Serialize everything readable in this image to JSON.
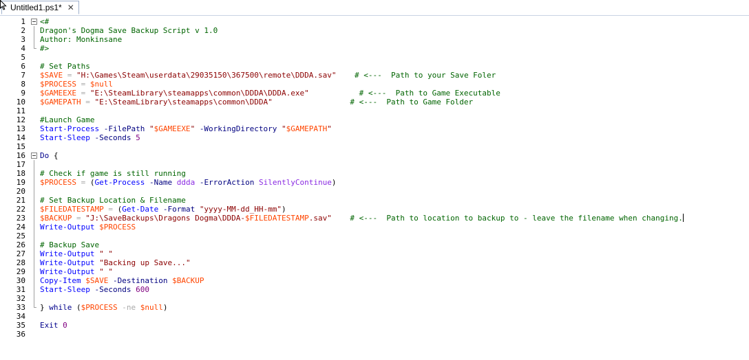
{
  "tab": {
    "title": "Untitled1.ps1*",
    "close_glyph": "✕"
  },
  "lines": [
    {
      "n": "1",
      "fold": "start",
      "tokens": [
        {
          "c": "comment",
          "t": "<#"
        }
      ]
    },
    {
      "n": "2",
      "fold": "line",
      "tokens": [
        {
          "c": "comment",
          "t": "Dragon's Dogma Save Backup Script v 1.0"
        }
      ]
    },
    {
      "n": "3",
      "fold": "line",
      "tokens": [
        {
          "c": "comment",
          "t": "Author: Monkinsane"
        }
      ]
    },
    {
      "n": "4",
      "fold": "end",
      "tokens": [
        {
          "c": "comment",
          "t": "#>"
        }
      ]
    },
    {
      "n": "5",
      "fold": "",
      "tokens": []
    },
    {
      "n": "6",
      "fold": "",
      "tokens": [
        {
          "c": "comment",
          "t": "# Set Paths"
        }
      ]
    },
    {
      "n": "7",
      "fold": "",
      "tokens": [
        {
          "c": "var",
          "t": "$SAVE"
        },
        {
          "c": "op",
          "t": " = "
        },
        {
          "c": "str",
          "t": "\"H:\\Games\\Steam\\userdata\\29035150\\367500\\remote\\DDDA.sav\""
        },
        {
          "c": "plain",
          "t": "    "
        },
        {
          "c": "comment",
          "t": "# <---  Path to your Save Foler"
        }
      ]
    },
    {
      "n": "8",
      "fold": "",
      "tokens": [
        {
          "c": "var",
          "t": "$PROCESS"
        },
        {
          "c": "op",
          "t": " = "
        },
        {
          "c": "var",
          "t": "$null"
        }
      ]
    },
    {
      "n": "9",
      "fold": "",
      "tokens": [
        {
          "c": "var",
          "t": "$GAMEEXE"
        },
        {
          "c": "op",
          "t": " = "
        },
        {
          "c": "str",
          "t": "\"E:\\SteamLibrary\\steamapps\\common\\DDDA\\DDDA.exe\""
        },
        {
          "c": "plain",
          "t": "           "
        },
        {
          "c": "comment",
          "t": "# <---  Path to Game Executable"
        }
      ]
    },
    {
      "n": "10",
      "fold": "",
      "tokens": [
        {
          "c": "var",
          "t": "$GAMEPATH"
        },
        {
          "c": "op",
          "t": " = "
        },
        {
          "c": "str",
          "t": "\"E:\\SteamLibrary\\steamapps\\common\\DDDA\""
        },
        {
          "c": "plain",
          "t": "                 "
        },
        {
          "c": "comment",
          "t": "# <---  Path to Game Folder"
        }
      ]
    },
    {
      "n": "11",
      "fold": "",
      "tokens": []
    },
    {
      "n": "12",
      "fold": "",
      "tokens": [
        {
          "c": "comment",
          "t": "#Launch Game"
        }
      ]
    },
    {
      "n": "13",
      "fold": "",
      "tokens": [
        {
          "c": "cmd",
          "t": "Start-Process"
        },
        {
          "c": "plain",
          "t": " "
        },
        {
          "c": "param",
          "t": "-FilePath"
        },
        {
          "c": "plain",
          "t": " "
        },
        {
          "c": "str",
          "t": "\""
        },
        {
          "c": "var",
          "t": "$GAMEEXE"
        },
        {
          "c": "str",
          "t": "\""
        },
        {
          "c": "plain",
          "t": " "
        },
        {
          "c": "param",
          "t": "-WorkingDirectory"
        },
        {
          "c": "plain",
          "t": " "
        },
        {
          "c": "str",
          "t": "\""
        },
        {
          "c": "var",
          "t": "$GAMEPATH"
        },
        {
          "c": "str",
          "t": "\""
        }
      ]
    },
    {
      "n": "14",
      "fold": "",
      "tokens": [
        {
          "c": "cmd",
          "t": "Start-Sleep"
        },
        {
          "c": "plain",
          "t": " "
        },
        {
          "c": "param",
          "t": "-Seconds"
        },
        {
          "c": "plain",
          "t": " "
        },
        {
          "c": "num",
          "t": "5"
        }
      ]
    },
    {
      "n": "15",
      "fold": "",
      "tokens": []
    },
    {
      "n": "16",
      "fold": "start",
      "tokens": [
        {
          "c": "kw",
          "t": "Do"
        },
        {
          "c": "plain",
          "t": " {"
        }
      ]
    },
    {
      "n": "17",
      "fold": "line",
      "tokens": []
    },
    {
      "n": "18",
      "fold": "line",
      "tokens": [
        {
          "c": "comment",
          "t": "# Check if game is still running"
        }
      ]
    },
    {
      "n": "19",
      "fold": "line",
      "tokens": [
        {
          "c": "var",
          "t": "$PROCESS"
        },
        {
          "c": "op",
          "t": " = "
        },
        {
          "c": "plain",
          "t": "("
        },
        {
          "c": "cmd",
          "t": "Get-Process"
        },
        {
          "c": "plain",
          "t": " "
        },
        {
          "c": "param",
          "t": "-Name"
        },
        {
          "c": "plain",
          "t": " "
        },
        {
          "c": "member",
          "t": "ddda"
        },
        {
          "c": "plain",
          "t": " "
        },
        {
          "c": "param",
          "t": "-ErrorAction"
        },
        {
          "c": "plain",
          "t": " "
        },
        {
          "c": "member",
          "t": "SilentlyContinue"
        },
        {
          "c": "plain",
          "t": ")"
        }
      ]
    },
    {
      "n": "20",
      "fold": "line",
      "tokens": []
    },
    {
      "n": "21",
      "fold": "line",
      "tokens": [
        {
          "c": "comment",
          "t": "# Set Backup Location & Filename"
        }
      ]
    },
    {
      "n": "22",
      "fold": "line",
      "tokens": [
        {
          "c": "var",
          "t": "$FILEDATESTAMP"
        },
        {
          "c": "op",
          "t": " = "
        },
        {
          "c": "plain",
          "t": "("
        },
        {
          "c": "cmd",
          "t": "Get-Date"
        },
        {
          "c": "plain",
          "t": " "
        },
        {
          "c": "param",
          "t": "-Format"
        },
        {
          "c": "plain",
          "t": " "
        },
        {
          "c": "str",
          "t": "\"yyyy-MM-dd_HH-mm\""
        },
        {
          "c": "plain",
          "t": ")"
        }
      ]
    },
    {
      "n": "23",
      "fold": "line",
      "caret": true,
      "tokens": [
        {
          "c": "var",
          "t": "$BACKUP"
        },
        {
          "c": "op",
          "t": " = "
        },
        {
          "c": "str",
          "t": "\"J:\\SaveBackups\\Dragons Dogma\\DDDA-"
        },
        {
          "c": "var",
          "t": "$FILEDATESTAMP"
        },
        {
          "c": "str",
          "t": ".sav\""
        },
        {
          "c": "plain",
          "t": "    "
        },
        {
          "c": "comment",
          "t": "# <---  Path to location to backup to - leave the filename when changing."
        }
      ]
    },
    {
      "n": "24",
      "fold": "line",
      "tokens": [
        {
          "c": "cmd",
          "t": "Write-Output"
        },
        {
          "c": "plain",
          "t": " "
        },
        {
          "c": "var",
          "t": "$PROCESS"
        }
      ]
    },
    {
      "n": "25",
      "fold": "line",
      "tokens": []
    },
    {
      "n": "26",
      "fold": "line",
      "tokens": [
        {
          "c": "comment",
          "t": "# Backup Save"
        }
      ]
    },
    {
      "n": "27",
      "fold": "line",
      "tokens": [
        {
          "c": "cmd",
          "t": "Write-Output"
        },
        {
          "c": "plain",
          "t": " "
        },
        {
          "c": "str",
          "t": "\" \""
        }
      ]
    },
    {
      "n": "28",
      "fold": "line",
      "tokens": [
        {
          "c": "cmd",
          "t": "Write-Output"
        },
        {
          "c": "plain",
          "t": " "
        },
        {
          "c": "str",
          "t": "\"Backing up Save...\""
        }
      ]
    },
    {
      "n": "29",
      "fold": "line",
      "tokens": [
        {
          "c": "cmd",
          "t": "Write-Output"
        },
        {
          "c": "plain",
          "t": " "
        },
        {
          "c": "str",
          "t": "\" \""
        }
      ]
    },
    {
      "n": "30",
      "fold": "line",
      "tokens": [
        {
          "c": "cmd",
          "t": "Copy-Item"
        },
        {
          "c": "plain",
          "t": " "
        },
        {
          "c": "var",
          "t": "$SAVE"
        },
        {
          "c": "plain",
          "t": " "
        },
        {
          "c": "param",
          "t": "-Destination"
        },
        {
          "c": "plain",
          "t": " "
        },
        {
          "c": "var",
          "t": "$BACKUP"
        }
      ]
    },
    {
      "n": "31",
      "fold": "line",
      "tokens": [
        {
          "c": "cmd",
          "t": "Start-Sleep"
        },
        {
          "c": "plain",
          "t": " "
        },
        {
          "c": "param",
          "t": "-Seconds"
        },
        {
          "c": "plain",
          "t": " "
        },
        {
          "c": "num",
          "t": "600"
        }
      ]
    },
    {
      "n": "32",
      "fold": "line",
      "tokens": []
    },
    {
      "n": "33",
      "fold": "end",
      "tokens": [
        {
          "c": "plain",
          "t": "} "
        },
        {
          "c": "kw",
          "t": "while"
        },
        {
          "c": "plain",
          "t": " ("
        },
        {
          "c": "var",
          "t": "$PROCESS"
        },
        {
          "c": "plain",
          "t": " "
        },
        {
          "c": "op",
          "t": "-ne"
        },
        {
          "c": "plain",
          "t": " "
        },
        {
          "c": "var",
          "t": "$null"
        },
        {
          "c": "plain",
          "t": ")"
        }
      ]
    },
    {
      "n": "34",
      "fold": "",
      "tokens": []
    },
    {
      "n": "35",
      "fold": "",
      "tokens": [
        {
          "c": "kw",
          "t": "Exit"
        },
        {
          "c": "plain",
          "t": " "
        },
        {
          "c": "num",
          "t": "0"
        }
      ]
    },
    {
      "n": "36",
      "fold": "",
      "tokens": []
    }
  ],
  "colors": {
    "comment": "#006400",
    "variable": "#ff4500",
    "string": "#8b0000",
    "command": "#0000ff",
    "parameter": "#000080",
    "number": "#800080",
    "operator": "#a9a9a9",
    "keyword": "#00008b",
    "member": "#8a2be2"
  }
}
